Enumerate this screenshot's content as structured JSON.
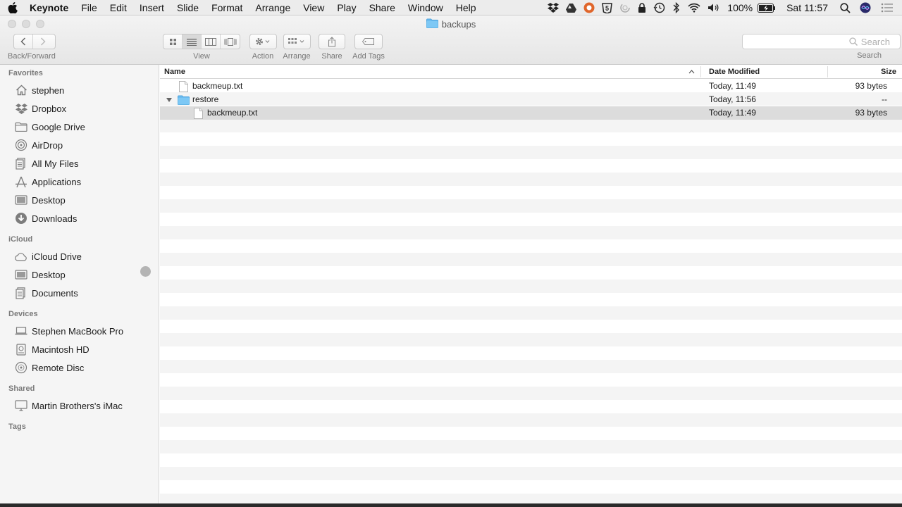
{
  "menubar": {
    "app": "Keynote",
    "items": [
      "File",
      "Edit",
      "Insert",
      "Slide",
      "Format",
      "Arrange",
      "View",
      "Play",
      "Share",
      "Window",
      "Help"
    ],
    "battery": "100%",
    "clock": "Sat 11:57"
  },
  "window": {
    "title": "backups"
  },
  "toolbar": {
    "back_forward_label": "Back/Forward",
    "view_label": "View",
    "action_label": "Action",
    "arrange_label": "Arrange",
    "share_label": "Share",
    "add_tags_label": "Add Tags",
    "search_placeholder": "Search",
    "search_label": "Search"
  },
  "sidebar": {
    "favorites_header": "Favorites",
    "favorites": [
      "stephen",
      "Dropbox",
      "Google Drive",
      "AirDrop",
      "All My Files",
      "Applications",
      "Desktop",
      "Downloads"
    ],
    "icloud_header": "iCloud",
    "icloud": [
      "iCloud Drive",
      "Desktop",
      "Documents"
    ],
    "devices_header": "Devices",
    "devices": [
      "Stephen MacBook Pro",
      "Macintosh HD",
      "Remote Disc"
    ],
    "shared_header": "Shared",
    "shared": [
      "Martin Brothers's iMac"
    ],
    "tags_header": "Tags"
  },
  "list": {
    "columns": {
      "name": "Name",
      "date": "Date Modified",
      "size": "Size"
    },
    "rows": [
      {
        "name": "backmeup.txt",
        "date": "Today, 11:49",
        "size": "93 bytes"
      },
      {
        "name": "restore",
        "date": "Today, 11:56",
        "size": "--"
      },
      {
        "name": "backmeup.txt",
        "date": "Today, 11:49",
        "size": "93 bytes"
      }
    ]
  }
}
